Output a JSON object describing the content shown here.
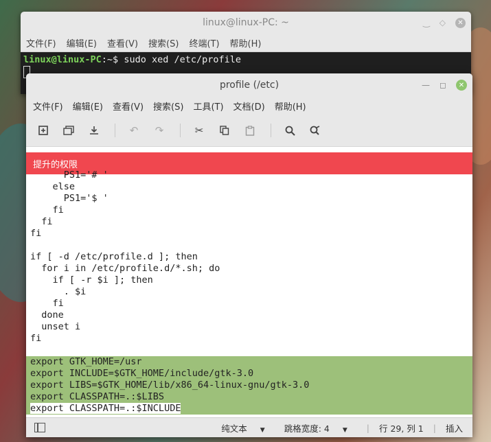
{
  "terminal": {
    "title": "linux@linux-PC: ~",
    "menu": [
      "文件(F)",
      "编辑(E)",
      "查看(V)",
      "搜索(S)",
      "终端(T)",
      "帮助(H)"
    ],
    "prompt_user": "linux@linux-PC",
    "prompt_path": ":~$",
    "command": " sudo xed /etc/profile"
  },
  "editor": {
    "title": "profile (/etc)",
    "menu": [
      "文件(F)",
      "编辑(E)",
      "查看(V)",
      "搜索(S)",
      "工具(T)",
      "文档(D)",
      "帮助(H)"
    ],
    "banner": "提升的权限",
    "code_lines": [
      "      PS1='# '",
      "    else",
      "      PS1='$ '",
      "    fi",
      "  fi",
      "fi",
      "",
      "if [ -d /etc/profile.d ]; then",
      "  for i in /etc/profile.d/*.sh; do",
      "    if [ -r $i ]; then",
      "      . $i",
      "    fi",
      "  done",
      "  unset i",
      "fi",
      ""
    ],
    "highlighted_lines": [
      "export GTK_HOME=/usr",
      "export INCLUDE=$GTK_HOME/include/gtk-3.0",
      "export LIBS=$GTK_HOME/lib/x86_64-linux-gnu/gtk-3.0",
      "export CLASSPATH=.:$LIBS",
      "export CLASSPATH=.:$INCLUDE"
    ],
    "status": {
      "syntax": "纯文本",
      "tab_width": "跳格宽度: 4",
      "position": "行 29, 列 1",
      "mode": "插入"
    }
  },
  "icons": {
    "new": "new-file-icon",
    "open": "open-icon",
    "save": "save-icon",
    "undo": "undo-icon",
    "redo": "redo-icon",
    "cut": "cut-icon",
    "copy": "copy-icon",
    "paste": "paste-icon",
    "search": "search-icon",
    "replace": "replace-icon"
  },
  "colors": {
    "banner": "#f0474f",
    "highlight": "#9dc07a",
    "prompt_user": "#7dd35b"
  }
}
